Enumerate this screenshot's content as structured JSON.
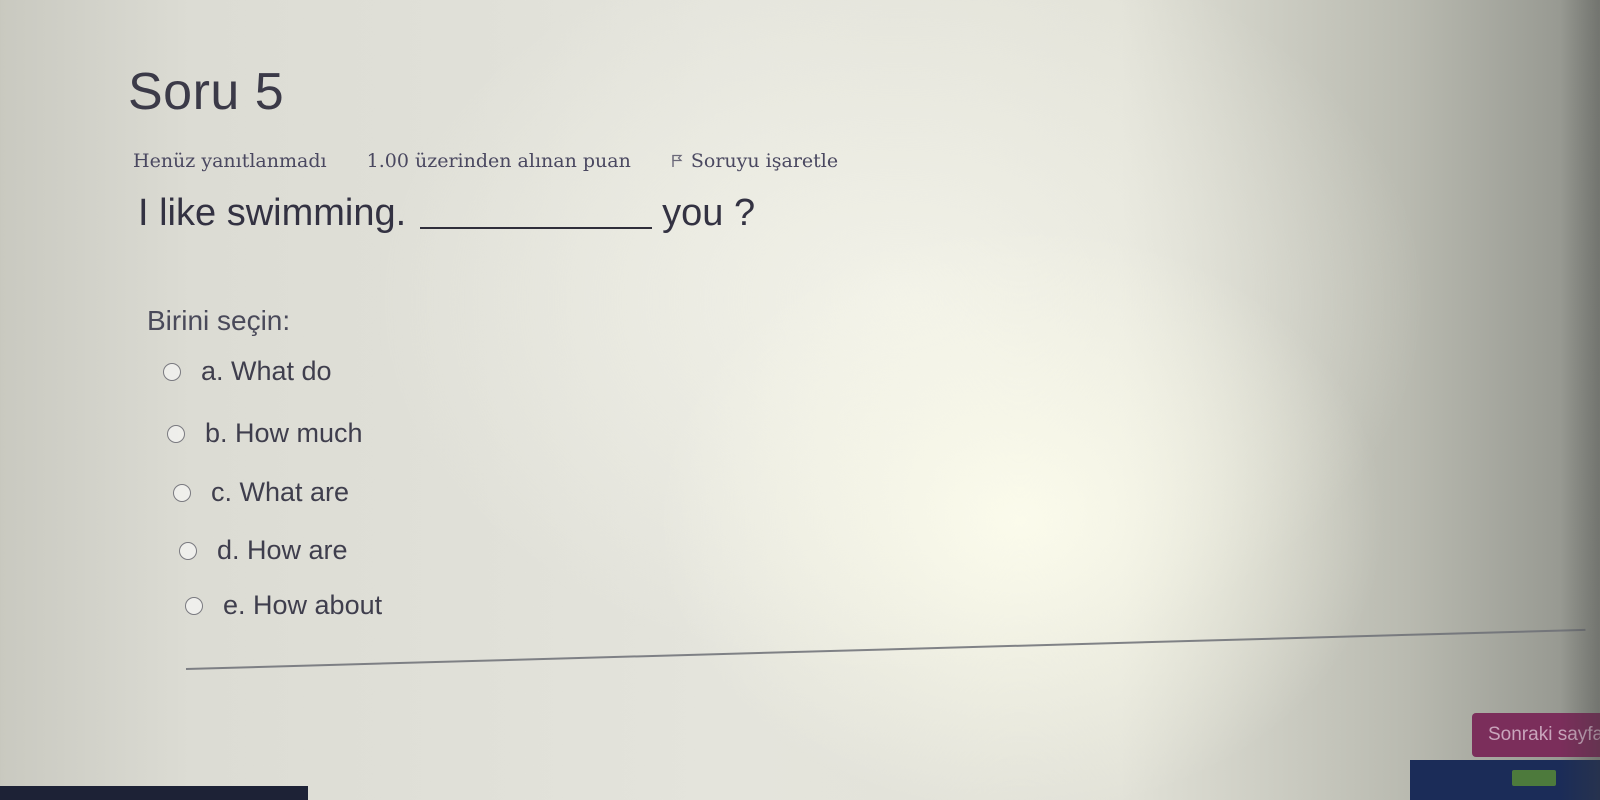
{
  "question": {
    "title": "Soru 5",
    "status": "Henüz yanıtlanmadı",
    "grade": "1.00 üzerinden alınan puan",
    "flag_label": "Soruyu işaretle",
    "text_before": "I like swimming.",
    "text_after": "you ?",
    "prompt": "Birini seçin:",
    "options": [
      {
        "label": "a. What do"
      },
      {
        "label": "b. How much"
      },
      {
        "label": "c. What are"
      },
      {
        "label": "d. How are"
      },
      {
        "label": "e. How about"
      }
    ]
  },
  "navigation": {
    "next_label": "Sonraki sayfa"
  },
  "icons": {
    "flag": "flag-icon"
  },
  "colors": {
    "next_button": "#7b2e5b",
    "taskbar": "#1b2c58"
  }
}
